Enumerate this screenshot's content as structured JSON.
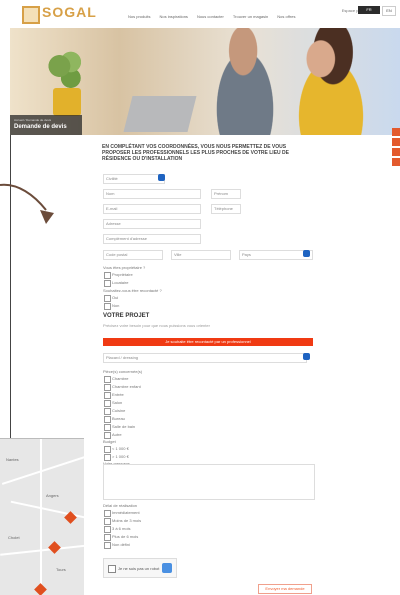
{
  "header": {
    "logo_text": "SOGAL",
    "nav": [
      "Nos produits",
      "Nos inspirations",
      "Nous contacter",
      "Trouver un magasin",
      "Nos offres"
    ],
    "top_links": "Espace pro",
    "btn_1": "FR",
    "btn_2": "EN"
  },
  "hero": {
    "breadcrumb": "Accueil / Demande de devis",
    "title": "Demande de devis"
  },
  "form": {
    "intro": "EN COMPLÉTANT VOS COORDONNÉES, VOUS NOUS PERMETTEZ DE VOUS PROPOSER LES PROFESSIONNELS LES PLUS PROCHES DE VOTRE LIEU DE RÉSIDENCE OU D'INSTALLATION",
    "civility_label": "Civilité",
    "name_label": "Nom",
    "first_name_label": "Prénom",
    "email_label": "E-mail",
    "phone_label": "Téléphone",
    "address_label": "Adresse",
    "address2_label": "Complément d'adresse",
    "postcode_label": "Code postal",
    "city_label": "Ville",
    "country_label": "Pays",
    "q1_label": "Vous êtes propriétaire ?",
    "q1_options": [
      "Propriétaire",
      "Locataire"
    ],
    "q2_label": "Souhaitez-vous être recontacté ?",
    "q2_options": [
      "Oui",
      "Non"
    ],
    "project_title": "VOTRE PROJET",
    "project_sub": "Précisez votre besoin pour que nous puissions vous orienter",
    "cta_red": "Je souhaite être recontacté par un professionnel",
    "project_type_label": "Type de projet",
    "project_type_value": "Placard / dressing",
    "rooms_label": "Pièce(s) concernée(s)",
    "rooms": [
      "Chambre",
      "Chambre enfant",
      "Entrée",
      "Salon",
      "Cuisine",
      "Bureau",
      "Salle de bain",
      "Autre"
    ],
    "budget_label": "Budget",
    "budget_options": [
      "< 1 000 €",
      "> 1 000 €"
    ],
    "message_label": "Votre message",
    "deadline_label": "Délai de réalisation",
    "deadline_options": [
      "Immédiatement",
      "Moins de 3 mois",
      "3 à 6 mois",
      "Plus de 6 mois",
      "Non défini"
    ],
    "captcha_label": "Je ne suis pas un robot",
    "submit": "Envoyer ma demande"
  },
  "map": {
    "labels": [
      "Nantes",
      "Angers",
      "Cholet",
      "Tours"
    ]
  },
  "accents": {
    "orange": "#f03a13",
    "blue": "#1e63c1"
  }
}
